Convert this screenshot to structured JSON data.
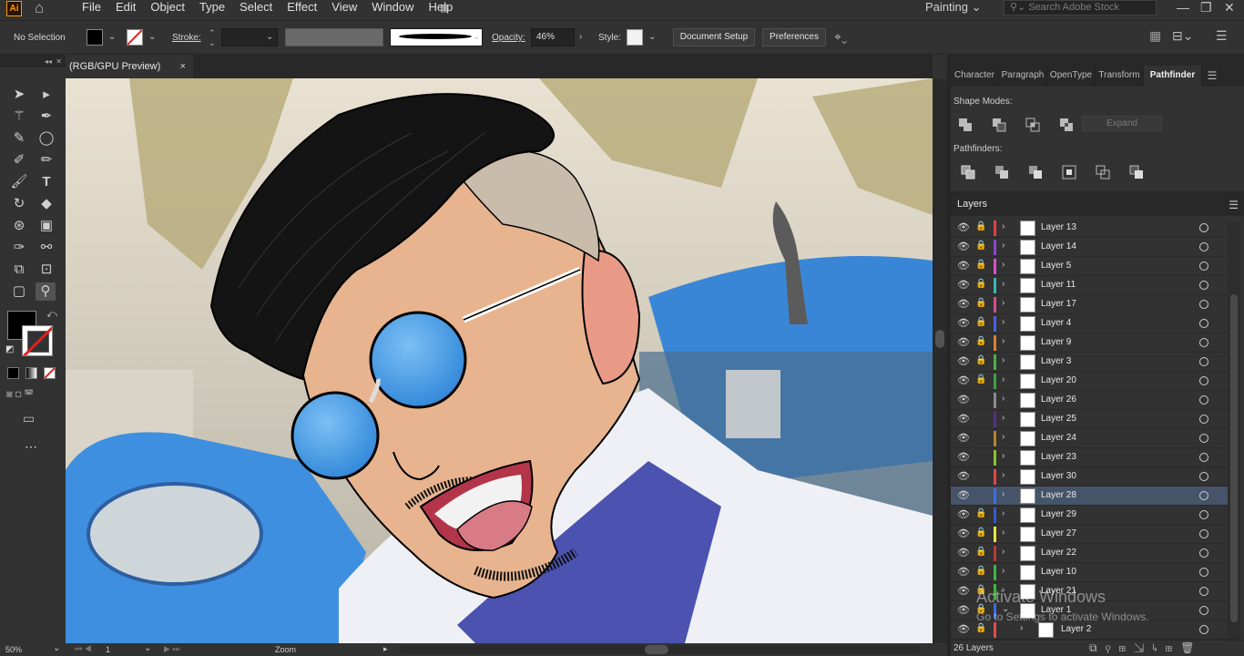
{
  "app": {
    "logo": "Ai",
    "icon_home": "home-icon"
  },
  "menu": [
    "File",
    "Edit",
    "Object",
    "Type",
    "Select",
    "Effect",
    "View",
    "Window",
    "Help"
  ],
  "workspace": {
    "name": "Painting",
    "search_placeholder": "Search Adobe Stock"
  },
  "control": {
    "selection": "No Selection",
    "stroke_label": "Stroke:",
    "opacity_label": "Opacity:",
    "opacity_value": "46%",
    "style_label": "Style:",
    "document_setup": "Document Setup",
    "preferences": "Preferences"
  },
  "document": {
    "tab_title": "(RGB/GPU Preview)",
    "close": "×"
  },
  "panel_tabs": [
    "Character",
    "Paragraph",
    "OpenType",
    "Transform",
    "Pathfinder"
  ],
  "pathfinder": {
    "shape_modes_label": "Shape Modes:",
    "expand_label": "Expand",
    "pathfinders_label": "Pathfinders:"
  },
  "layers": {
    "title": "Layers",
    "count": "26 Layers",
    "rows": [
      {
        "name": "Layer 13",
        "color": "#e0413f",
        "locked": true,
        "selected": false
      },
      {
        "name": "Layer 14",
        "color": "#8a44d6",
        "locked": true,
        "selected": false
      },
      {
        "name": "Layer 5",
        "color": "#d74cd6",
        "locked": true,
        "selected": false
      },
      {
        "name": "Layer 11",
        "color": "#39b8b8",
        "locked": true,
        "selected": false
      },
      {
        "name": "Layer 17",
        "color": "#d94b8a",
        "locked": true,
        "selected": false
      },
      {
        "name": "Layer 4",
        "color": "#4960e6",
        "locked": true,
        "selected": false
      },
      {
        "name": "Layer 9",
        "color": "#e0802c",
        "locked": true,
        "selected": false
      },
      {
        "name": "Layer 3",
        "color": "#48b348",
        "locked": true,
        "selected": false
      },
      {
        "name": "Layer 20",
        "color": "#3fa33f",
        "locked": true,
        "selected": false
      },
      {
        "name": "Layer 26",
        "color": "#8a8a8a",
        "locked": false,
        "selected": false
      },
      {
        "name": "Layer 25",
        "color": "#5a2e8a",
        "locked": false,
        "selected": false
      },
      {
        "name": "Layer 24",
        "color": "#b8822a",
        "locked": false,
        "selected": false
      },
      {
        "name": "Layer 23",
        "color": "#86c62a",
        "locked": false,
        "selected": false
      },
      {
        "name": "Layer 30",
        "color": "#e34646",
        "locked": false,
        "selected": false
      },
      {
        "name": "Layer 28",
        "color": "#3f6de6",
        "locked": false,
        "selected": true
      },
      {
        "name": "Layer 29",
        "color": "#3a58c9",
        "locked": true,
        "selected": false
      },
      {
        "name": "Layer 27",
        "color": "#e6e63a",
        "locked": true,
        "selected": false
      },
      {
        "name": "Layer 22",
        "color": "#b83a3a",
        "locked": true,
        "selected": false
      },
      {
        "name": "Layer 10",
        "color": "#3ab83a",
        "locked": true,
        "selected": false
      },
      {
        "name": "Layer 21",
        "color": "#3ab83a",
        "locked": true,
        "selected": false
      },
      {
        "name": "Layer 1",
        "color": "#3a6ae6",
        "locked": true,
        "selected": false
      },
      {
        "name": "Layer 2",
        "color": "#e64a4a",
        "locked": true,
        "selected": false
      }
    ]
  },
  "status": {
    "zoom": "50%",
    "page": "1",
    "tool": "Zoom"
  },
  "watermark": {
    "line1": "Activate Windows",
    "line2": "Go to Settings to activate Windows."
  }
}
